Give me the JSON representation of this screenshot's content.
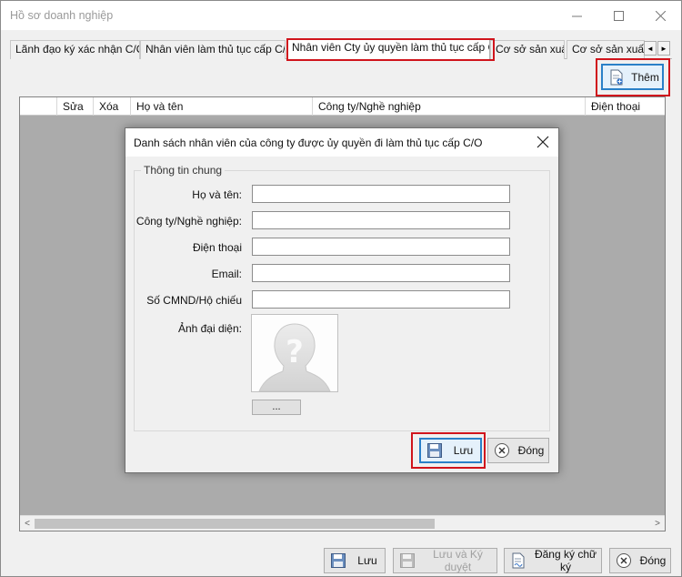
{
  "window": {
    "title": "Hồ sơ doanh nghiệp",
    "minimize_glyph": "—",
    "maximize_glyph": "☐",
    "close_glyph": "✕"
  },
  "tabs": [
    {
      "label": "Lãnh đạo ký xác nhận C/O",
      "active": false
    },
    {
      "label": "Nhân viên làm thủ tục cấp C/O",
      "active": false
    },
    {
      "label": "Nhân viên Cty ủy quyền làm thủ tục cấp C/O",
      "active": true
    },
    {
      "label": "Cơ sở sản xuất",
      "active": false
    },
    {
      "label": "Cơ sở sản xuất của",
      "active": false
    }
  ],
  "tab_scroll": {
    "left": "◄",
    "right": "►"
  },
  "toolbar": {
    "add_label": "Thêm",
    "add_icon": "document-add-icon"
  },
  "grid": {
    "columns": [
      "Sửa",
      "Xóa",
      "Họ và tên",
      "Công ty/Nghề nghiệp",
      "Điện thoại"
    ],
    "scroll_left": "<",
    "scroll_right": ">"
  },
  "dialog": {
    "title": "Danh sách nhân viên của công ty được ủy quyền đi làm thủ tục cấp C/O",
    "group_title": "Thông tin chung",
    "fields": [
      {
        "label": "Họ và tên:",
        "value": ""
      },
      {
        "label": "Công ty/Nghề nghiệp:",
        "value": ""
      },
      {
        "label": "Điện thoại",
        "value": ""
      },
      {
        "label": "Email:",
        "value": ""
      },
      {
        "label": "Số CMND/Hộ chiếu",
        "value": ""
      }
    ],
    "avatar_label": "Ảnh đại diện:",
    "browse_label": "...",
    "save_label": "Lưu",
    "close_label": "Đóng"
  },
  "footer": {
    "save_label": "Lưu",
    "save_approve_label": "Lưu và Ký duyệt",
    "register_signature_label": "Đăng ký chữ ký",
    "close_label": "Đóng"
  },
  "colors": {
    "highlight": "#d0141c",
    "focus_border": "#2a80c8",
    "grid_background": "#ababab"
  }
}
